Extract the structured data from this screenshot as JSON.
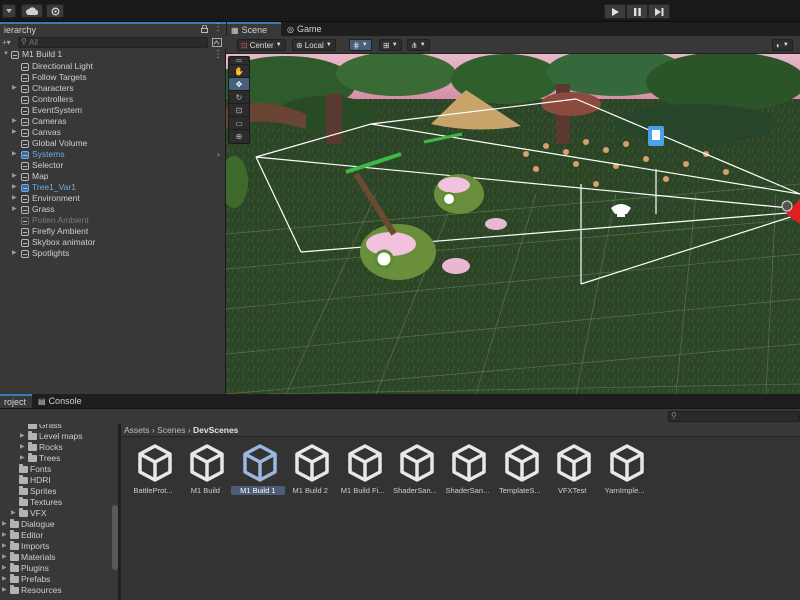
{
  "toolbar": {
    "account_icon": "cloud-icon",
    "settings_icon": "gear-icon",
    "play_icon": "play-icon",
    "pause_icon": "pause-icon",
    "step_icon": "step-icon"
  },
  "hierarchy": {
    "tab_label": "ierarchy",
    "search_placeholder": "All",
    "root": "M1 Build 1",
    "items": [
      {
        "label": "Directional Light",
        "expandable": false,
        "state": "normal"
      },
      {
        "label": "Follow Targets",
        "expandable": false,
        "state": "normal"
      },
      {
        "label": "Characters",
        "expandable": true,
        "state": "normal"
      },
      {
        "label": "Controllers",
        "expandable": false,
        "state": "normal"
      },
      {
        "label": "EventSystem",
        "expandable": false,
        "state": "normal"
      },
      {
        "label": "Cameras",
        "expandable": true,
        "state": "normal"
      },
      {
        "label": "Canvas",
        "expandable": true,
        "state": "normal"
      },
      {
        "label": "Global Volume",
        "expandable": false,
        "state": "normal"
      },
      {
        "label": "Systems",
        "expandable": true,
        "state": "prefab"
      },
      {
        "label": "Selector",
        "expandable": false,
        "state": "normal"
      },
      {
        "label": "Map",
        "expandable": true,
        "state": "normal"
      },
      {
        "label": "Tree1_Var1",
        "expandable": true,
        "state": "prefab"
      },
      {
        "label": "Environment",
        "expandable": true,
        "state": "normal"
      },
      {
        "label": "Grass",
        "expandable": true,
        "state": "normal"
      },
      {
        "label": "Pollen Ambient",
        "expandable": false,
        "state": "disabled"
      },
      {
        "label": "Firefly Ambient",
        "expandable": false,
        "state": "normal"
      },
      {
        "label": "Skybox animator",
        "expandable": false,
        "state": "normal"
      },
      {
        "label": "Spotlights",
        "expandable": true,
        "state": "normal"
      }
    ]
  },
  "scene": {
    "tabs": [
      {
        "label": "Scene",
        "icon": "scene-icon",
        "active": true
      },
      {
        "label": "Game",
        "icon": "gamepad-icon",
        "active": false
      }
    ],
    "pivot_label": "Center",
    "space_label": "Local",
    "tools": [
      "hand-icon",
      "move-icon",
      "rotate-icon",
      "scale-icon",
      "rect-icon",
      "transform-icon"
    ]
  },
  "project": {
    "tabs": [
      {
        "label": "roject",
        "active": true
      },
      {
        "label": "Console",
        "active": false
      }
    ],
    "breadcrumb": [
      "Assets",
      "Scenes",
      "DevScenes"
    ],
    "folders": [
      {
        "label": "Grass",
        "depth": 2,
        "expandable": false
      },
      {
        "label": "Level maps",
        "depth": 2,
        "expandable": true
      },
      {
        "label": "Rocks",
        "depth": 2,
        "expandable": true
      },
      {
        "label": "Trees",
        "depth": 2,
        "expandable": true
      },
      {
        "label": "Fonts",
        "depth": 1,
        "expandable": false
      },
      {
        "label": "HDRI",
        "depth": 1,
        "expandable": false
      },
      {
        "label": "Sprites",
        "depth": 1,
        "expandable": false
      },
      {
        "label": "Textures",
        "depth": 1,
        "expandable": false
      },
      {
        "label": "VFX",
        "depth": 1,
        "expandable": true
      },
      {
        "label": "Dialogue",
        "depth": 0,
        "expandable": true
      },
      {
        "label": "Editor",
        "depth": 0,
        "expandable": true
      },
      {
        "label": "Imports",
        "depth": 0,
        "expandable": true
      },
      {
        "label": "Materials",
        "depth": 0,
        "expandable": true
      },
      {
        "label": "Plugins",
        "depth": 0,
        "expandable": true
      },
      {
        "label": "Prefabs",
        "depth": 0,
        "expandable": true
      },
      {
        "label": "Resources",
        "depth": 0,
        "expandable": true
      }
    ],
    "assets": [
      {
        "label": "BattleProt...",
        "selected": false
      },
      {
        "label": "M1 Build",
        "selected": false
      },
      {
        "label": "M1 Build 1",
        "selected": true
      },
      {
        "label": "M1 Build 2",
        "selected": false
      },
      {
        "label": "M1 Build Fi...",
        "selected": false
      },
      {
        "label": "ShaderSan...",
        "selected": false
      },
      {
        "label": "ShaderSan...",
        "selected": false
      },
      {
        "label": "TemplateS...",
        "selected": false
      },
      {
        "label": "VFXTest",
        "selected": false
      },
      {
        "label": "YarnImple...",
        "selected": false
      }
    ]
  },
  "colors": {
    "accent": "#3a79bb",
    "prefab_blue": "#6aaee8",
    "grass": "#2f4a29"
  }
}
